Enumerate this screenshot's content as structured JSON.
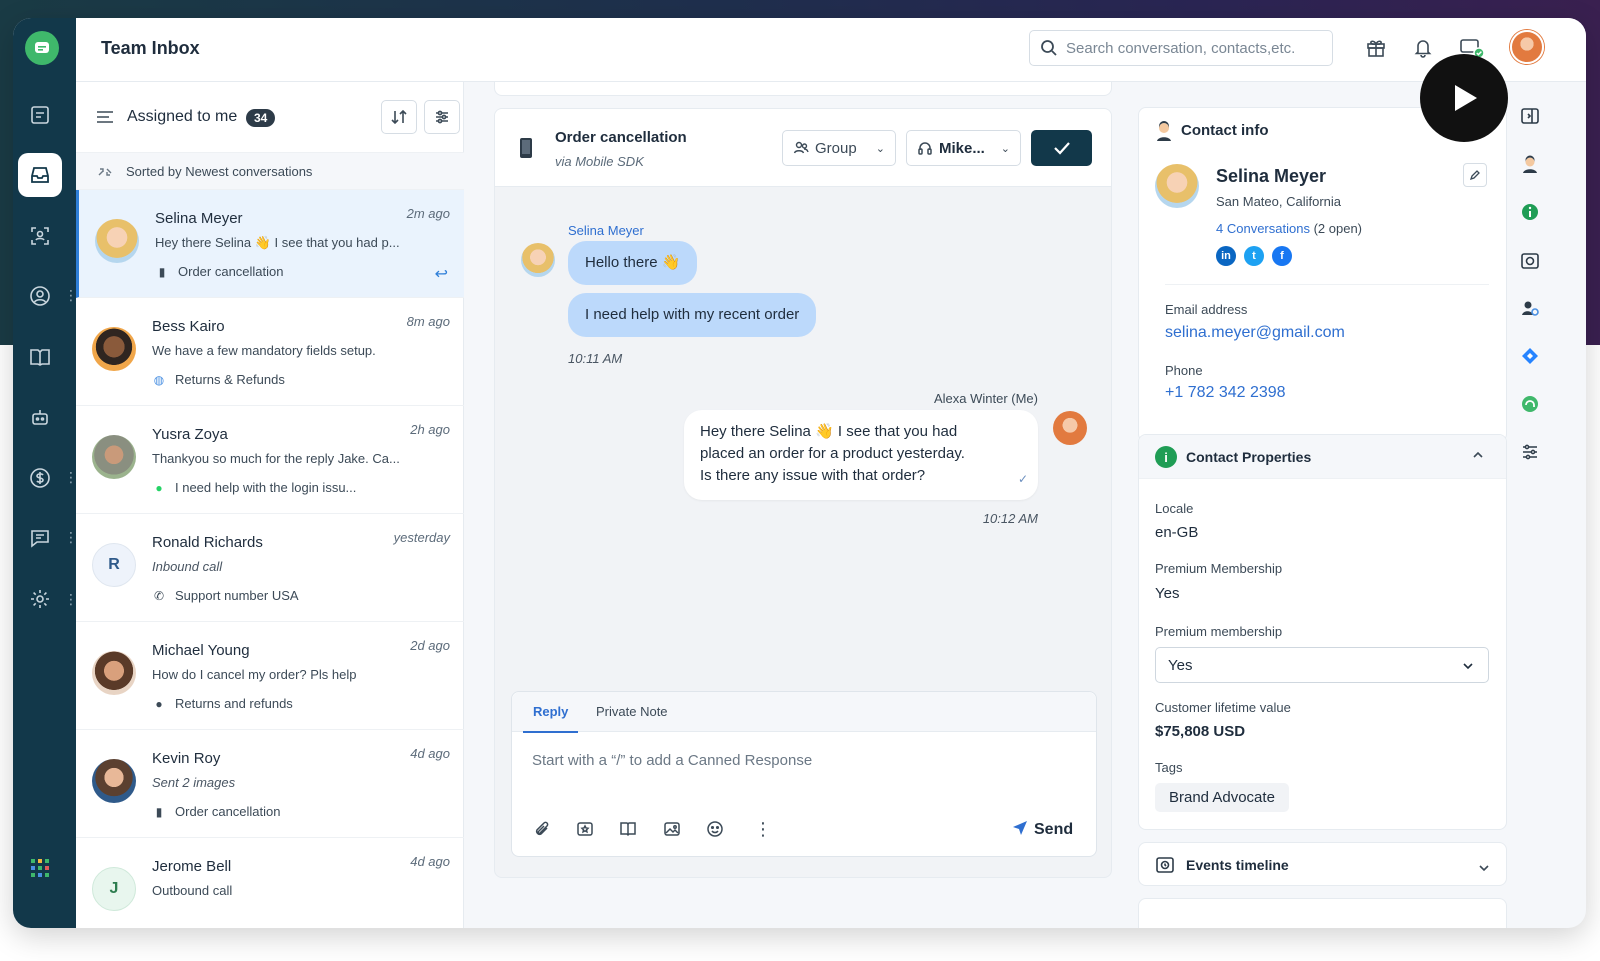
{
  "header": {
    "title": "Team Inbox",
    "search_placeholder": "Search conversation, contacts,etc."
  },
  "list": {
    "filter_label": "Assigned to me",
    "count": "34",
    "sort_label": "Sorted by Newest conversations",
    "conversations": [
      {
        "name": "Selina Meyer",
        "time": "2m ago",
        "message": "Hey there Selina 👋 I see that you had p...",
        "channel": "Order cancellation",
        "channel_icon": "mobile-icon"
      },
      {
        "name": "Bess Kairo",
        "time": "8m ago",
        "message": "We have a few mandatory fields setup.",
        "channel": "Returns & Refunds",
        "channel_icon": "globe-icon"
      },
      {
        "name": "Yusra Zoya",
        "time": "2h ago",
        "message": "Thankyou so much for the reply Jake. Ca...",
        "channel": "I need help with the login issu...",
        "channel_icon": "whatsapp-icon"
      },
      {
        "name": "Ronald Richards",
        "time": "yesterday",
        "message": "Inbound call",
        "channel": "Support number USA",
        "channel_icon": "phone-icon",
        "initial": "R"
      },
      {
        "name": "Michael Young",
        "time": "2d ago",
        "message": "How do I cancel my order? Pls help",
        "channel": "Returns and refunds",
        "channel_icon": "apple-icon"
      },
      {
        "name": "Kevin Roy",
        "time": "4d ago",
        "message": "Sent 2 images",
        "channel": "Order cancellation",
        "channel_icon": "mobile-icon"
      },
      {
        "name": "Jerome Bell",
        "time": "4d ago",
        "message": "Outbound call",
        "channel": "",
        "channel_icon": "phone-icon",
        "initial": "J"
      }
    ]
  },
  "conversation": {
    "title": "Order cancellation",
    "subtitle": "via Mobile SDK",
    "group_label": "Group",
    "agent_label": "Mike...",
    "customer_name": "Selina Meyer",
    "msg1": "Hello there 👋",
    "msg2": "I need help with my recent order",
    "time1": "10:11 AM",
    "agent_name": "Alexa Winter (Me)",
    "msg3_line1": "Hey there Selina 👋 I see that you had",
    "msg3_line2": "placed an order for a product yesterday.",
    "msg3_line3": "Is there any issue with that order?",
    "time2": "10:12 AM"
  },
  "composer": {
    "tab_reply": "Reply",
    "tab_note": "Private Note",
    "placeholder": "Start with a “/” to add a Canned Response",
    "send_label": "Send"
  },
  "contact": {
    "panel_title": "Contact info",
    "name": "Selina Meyer",
    "location": "San Mateo, California",
    "conversations_link": "4 Conversations",
    "conversations_open": "(2 open)",
    "email_label": "Email address",
    "email": "selina.meyer@gmail.com",
    "phone_label": "Phone",
    "phone": "+1 782 342 2398"
  },
  "properties": {
    "title": "Contact Properties",
    "locale_label": "Locale",
    "locale": "en-GB",
    "premium_label": "Premium Membership",
    "premium": "Yes",
    "premium2_label": "Premium membership",
    "premium2": "Yes",
    "clv_label": "Customer lifetime value",
    "clv": "$75,808 USD",
    "tags_label": "Tags",
    "tag": "Brand Advocate"
  },
  "events": {
    "title": "Events timeline"
  },
  "colors": {
    "rail": "#12384a",
    "accent": "#2f6fd0",
    "incoming_bubble": "#bcd9fb",
    "brand_green": "#3fb86b"
  }
}
